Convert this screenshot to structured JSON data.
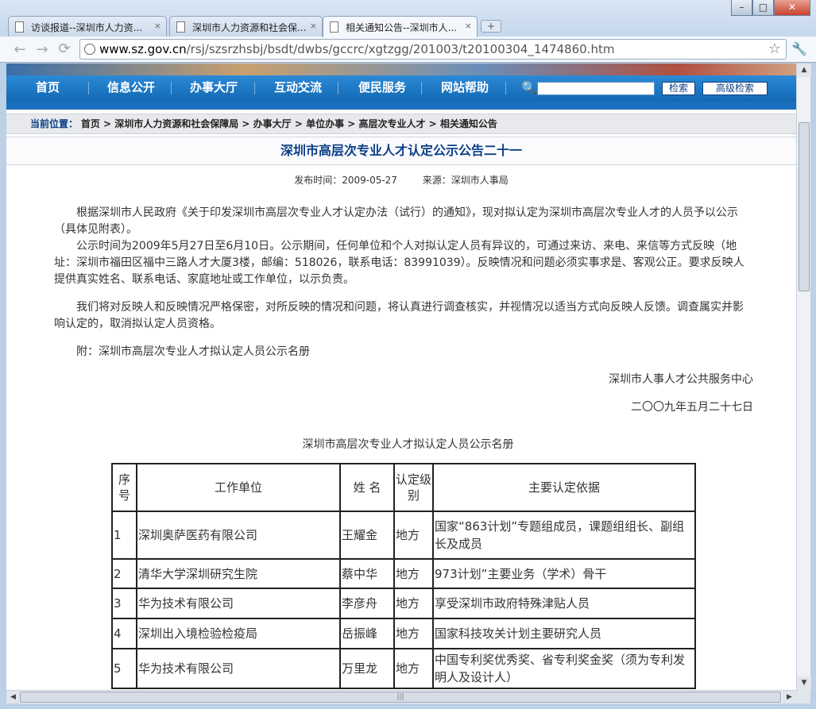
{
  "browser": {
    "tabs": [
      {
        "label": "访谈报道--深圳市人力资..."
      },
      {
        "label": "深圳市人力资源和社会保..."
      },
      {
        "label": "相关通知公告--深圳市人..."
      }
    ],
    "new_tab": "+",
    "close_glyph": "×",
    "window_controls": {
      "minimize": "–",
      "maximize": "□",
      "close": "✕"
    },
    "back": "←",
    "forward": "→",
    "url_domain": "www.sz.gov.cn",
    "url_path": "/rsj/szsrzhsbj/bsdt/dwbs/gccrc/xgtzgg/201003/t20100304_1474860.htm",
    "star": "☆",
    "wrench": "🔧"
  },
  "site_nav": {
    "items": [
      "首页",
      "信息公开",
      "办事大厅",
      "互动交流",
      "便民服务",
      "网站帮助"
    ],
    "search_icon": "🔍",
    "search_button": "检索",
    "advanced_search_button": "高级检索"
  },
  "breadcrumb": {
    "label": "当前位置：",
    "path": "首页 > 深圳市人力资源和社会保障局 > 办事大厅 > 单位办事 > 高层次专业人才 > 相关通知公告"
  },
  "article": {
    "title": "深圳市高层次专业人才认定公示公告二十一",
    "publish_time": "发布时间：2009-05-27",
    "source": "来源：深圳市人事局",
    "paragraphs": [
      "根据深圳市人民政府《关于印发深圳市高层次专业人才认定办法（试行）的通知》，现对拟认定为深圳市高层次专业人才的人员予以公示（具体见附表）。",
      "公示时间为2009年5月27日至6月10日。公示期间，任何单位和个人对拟认定人员有异议的，可通过来访、来电、来信等方式反映（地址：深圳市福田区福中三路人才大厦3楼，邮编：518026，联系电话：83991039）。反映情况和问题必须实事求是、客观公正。要求反映人提供真实姓名、联系电话、家庭地址或工作单位，以示负责。",
      "我们将对反映人和反映情况严格保密，对所反映的情况和问题，将认真进行调查核实，并视情况以适当方式向反映人反馈。调查属实并影响认定的，取消拟认定人员资格。",
      "附：深圳市高层次专业人才拟认定人员公示名册"
    ],
    "signature_org": "深圳市人事人才公共服务中心",
    "signature_date": "二〇〇九年五月二十七日",
    "list_title": "深圳市高层次专业人才拟认定人员公示名册"
  },
  "table": {
    "headers": [
      "序号",
      "工作单位",
      "姓 名",
      "认定级别",
      "主要认定依据"
    ],
    "rows": [
      [
        "1",
        "深圳奥萨医药有限公司",
        "王耀金",
        "地方",
        "国家“863计划”专题组成员，课题组组长、副组长及成员"
      ],
      [
        "2",
        "清华大学深圳研究生院",
        "蔡中华",
        "地方",
        "973计划”主要业务（学术）骨干"
      ],
      [
        "3",
        "华为技术有限公司",
        "李彦舟",
        "地方",
        "享受深圳市政府特殊津贴人员"
      ],
      [
        "4",
        "深圳出入境检验检疫局",
        "岳振峰",
        "地方",
        "国家科技攻关计划主要研究人员"
      ],
      [
        "5",
        "华为技术有限公司",
        "万里龙",
        "地方",
        "中国专利奖优秀奖、省专利奖金奖（须为专利发明人及设计人）"
      ]
    ]
  },
  "scrollbar": {
    "up": "▲",
    "down": "▼",
    "left": "◀",
    "right": "▶",
    "grip": "|||"
  }
}
